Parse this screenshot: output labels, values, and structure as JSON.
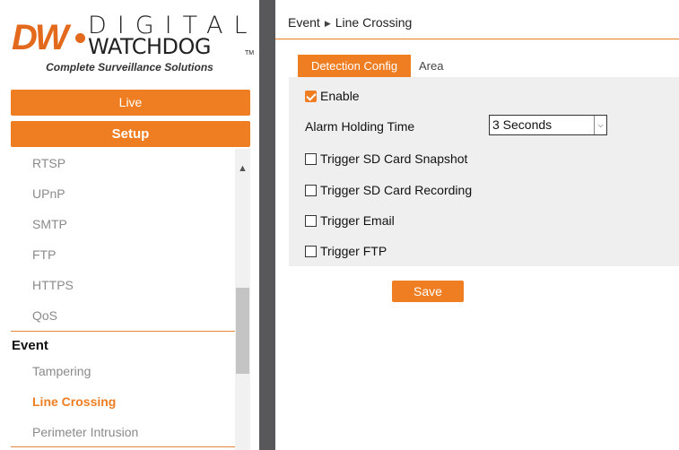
{
  "logo": {
    "brand_mark": "DW",
    "name_line1": "DIGITAL",
    "name_line2": "WATCHDOG",
    "trademark": "TM",
    "tagline": "Complete Surveillance Solutions"
  },
  "nav": {
    "live_label": "Live",
    "setup_label": "Setup"
  },
  "menu": {
    "items_top": [
      "RTSP",
      "UPnP",
      "SMTP",
      "FTP",
      "HTTPS",
      "QoS"
    ],
    "event_section": "Event",
    "items_event": [
      "Tampering",
      "Line Crossing",
      "Perimeter Intrusion"
    ],
    "active_item": "Line Crossing"
  },
  "breadcrumb": {
    "section": "Event",
    "page": "Line Crossing"
  },
  "tabs": {
    "detection": "Detection Config",
    "area": "Area"
  },
  "config": {
    "enable_label": "Enable",
    "enable_checked": true,
    "alarm_holding_label": "Alarm Holding Time",
    "alarm_holding_value": "3 Seconds",
    "snapshot_label": "Trigger SD Card Snapshot",
    "snapshot_checked": false,
    "recording_label": "Trigger SD Card Recording",
    "recording_checked": false,
    "email_label": "Trigger Email",
    "email_checked": false,
    "ftp_label": "Trigger FTP",
    "ftp_checked": false
  },
  "actions": {
    "save_label": "Save"
  },
  "colors": {
    "accent": "#ef7d22",
    "divider": "#58585a",
    "panel": "#efefef"
  }
}
